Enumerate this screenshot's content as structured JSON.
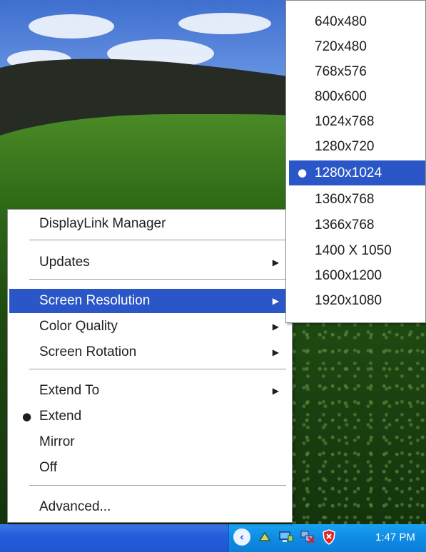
{
  "context_menu": {
    "items": [
      {
        "label": "DisplayLink Manager"
      },
      {
        "label": "Updates",
        "submenu": true
      },
      {
        "label": "Screen Resolution",
        "submenu": true,
        "highlighted": true
      },
      {
        "label": "Color Quality",
        "submenu": true
      },
      {
        "label": "Screen Rotation",
        "submenu": true
      },
      {
        "label": "Extend To",
        "submenu": true
      },
      {
        "label": "Extend",
        "checked": true,
        "bullet": "●"
      },
      {
        "label": "Mirror"
      },
      {
        "label": "Off"
      },
      {
        "label": "Advanced..."
      }
    ],
    "submenu_arrow": "▶"
  },
  "resolution_submenu": {
    "items": [
      {
        "label": "640x480"
      },
      {
        "label": "720x480"
      },
      {
        "label": "768x576"
      },
      {
        "label": "800x600"
      },
      {
        "label": "1024x768"
      },
      {
        "label": "1280x720"
      },
      {
        "label": "1280x1024",
        "selected": true,
        "bullet": "●"
      },
      {
        "label": "1360x768"
      },
      {
        "label": "1366x768"
      },
      {
        "label": "1400 X 1050"
      },
      {
        "label": "1600x1200"
      },
      {
        "label": "1920x1080"
      }
    ]
  },
  "taskbar": {
    "tray_icons": [
      "show-hidden-icons-chevron",
      "network-tool-icon",
      "displaylink-monitor-icon",
      "network-disconnected-icon",
      "security-shield-icon"
    ],
    "chevron_glyph": "‹",
    "time": "1:47 PM"
  },
  "colors": {
    "highlight": "#2a56c8",
    "taskbar": "#245edb",
    "tray": "#0f8be4"
  }
}
